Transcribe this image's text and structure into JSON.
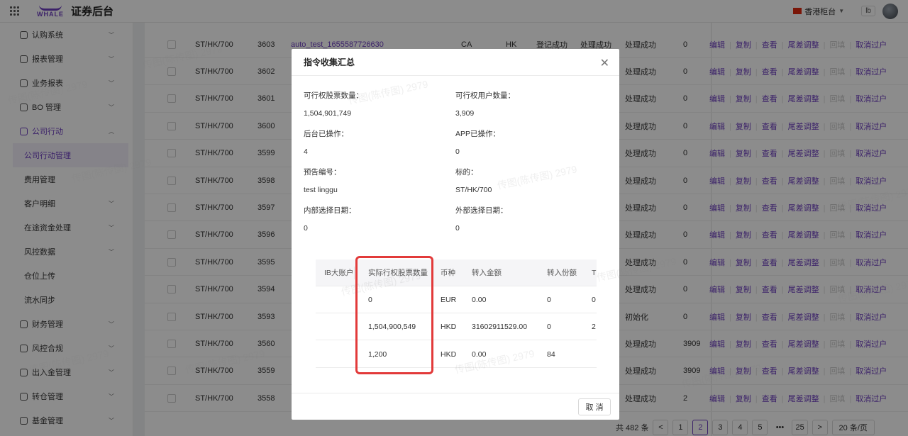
{
  "app": {
    "logo_text": "WHALE",
    "title": "证券后台",
    "region": "香港柜台",
    "user": "lb"
  },
  "sidebar": [
    {
      "label": "认购系统",
      "level": "top",
      "icon": "subscription-icon",
      "expand": "down"
    },
    {
      "label": "报表管理",
      "level": "top",
      "icon": "chart-icon",
      "expand": "down"
    },
    {
      "label": "业务报表",
      "level": "top",
      "icon": "report-icon",
      "expand": "down"
    },
    {
      "label": "BO 管理",
      "level": "top",
      "icon": "bo-icon",
      "expand": "down"
    },
    {
      "label": "公司行动",
      "level": "top",
      "icon": "calendar-icon",
      "expand": "up",
      "active": true
    },
    {
      "label": "公司行动管理",
      "level": "sub",
      "selected": true
    },
    {
      "label": "费用管理",
      "level": "sub"
    },
    {
      "label": "客户明细",
      "level": "sub",
      "expand": "down"
    },
    {
      "label": "在途资金处理",
      "level": "sub",
      "expand": "down"
    },
    {
      "label": "风控数据",
      "level": "sub",
      "expand": "down"
    },
    {
      "label": "仓位上传",
      "level": "sub"
    },
    {
      "label": "流水同步",
      "level": "sub"
    },
    {
      "label": "财务管理",
      "level": "top",
      "icon": "finance-icon",
      "expand": "down"
    },
    {
      "label": "风控合规",
      "level": "top",
      "icon": "shield-icon",
      "expand": "down"
    },
    {
      "label": "出入金管理",
      "level": "top",
      "icon": "transfer-icon",
      "expand": "down"
    },
    {
      "label": "转仓管理",
      "level": "top",
      "icon": "warehouse-icon",
      "expand": "down"
    },
    {
      "label": "基金管理",
      "level": "top",
      "icon": "fund-icon",
      "expand": "down"
    }
  ],
  "table": {
    "actions": {
      "edit": "编辑",
      "copy": "复制",
      "view": "查看",
      "adjust": "尾差调整",
      "backfill": "回填",
      "cancel": "取消过户"
    },
    "rows": [
      {
        "symbol": "ST/HK/700",
        "id": "3603",
        "name": "auto_test_1655587726630",
        "type": "CA",
        "market": "HK",
        "reg": "登记成功",
        "proc": "处理成功",
        "status": "处理成功",
        "count": "0"
      },
      {
        "symbol": "ST/HK/700",
        "id": "3602",
        "name": "",
        "type": "",
        "market": "",
        "reg": "",
        "proc": "",
        "status": "处理成功",
        "count": "0"
      },
      {
        "symbol": "ST/HK/700",
        "id": "3601",
        "name": "",
        "type": "",
        "market": "",
        "reg": "",
        "proc": "",
        "status": "处理成功",
        "count": "0"
      },
      {
        "symbol": "ST/HK/700",
        "id": "3600",
        "name": "",
        "type": "",
        "market": "",
        "reg": "",
        "proc": "",
        "status": "处理成功",
        "count": "0"
      },
      {
        "symbol": "ST/HK/700",
        "id": "3599",
        "name": "",
        "type": "",
        "market": "",
        "reg": "",
        "proc": "",
        "status": "处理成功",
        "count": "0"
      },
      {
        "symbol": "ST/HK/700",
        "id": "3598",
        "name": "",
        "type": "",
        "market": "",
        "reg": "",
        "proc": "",
        "status": "处理成功",
        "count": "0"
      },
      {
        "symbol": "ST/HK/700",
        "id": "3597",
        "name": "",
        "type": "",
        "market": "",
        "reg": "",
        "proc": "",
        "status": "处理成功",
        "count": "0"
      },
      {
        "symbol": "ST/HK/700",
        "id": "3596",
        "name": "",
        "type": "",
        "market": "",
        "reg": "",
        "proc": "",
        "status": "处理成功",
        "count": "0"
      },
      {
        "symbol": "ST/HK/700",
        "id": "3595",
        "name": "",
        "type": "",
        "market": "",
        "reg": "",
        "proc": "",
        "status": "处理成功",
        "count": "0"
      },
      {
        "symbol": "ST/HK/700",
        "id": "3594",
        "name": "",
        "type": "",
        "market": "",
        "reg": "",
        "proc": "",
        "status": "处理成功",
        "count": "0"
      },
      {
        "symbol": "ST/HK/700",
        "id": "3593",
        "name": "",
        "type": "",
        "market": "",
        "reg": "",
        "proc": "",
        "status": "初始化",
        "count": "0"
      },
      {
        "symbol": "ST/HK/700",
        "id": "3560",
        "name": "",
        "type": "",
        "market": "",
        "reg": "",
        "proc": "",
        "status": "处理成功",
        "count": "3909"
      },
      {
        "symbol": "ST/HK/700",
        "id": "3559",
        "name": "",
        "type": "",
        "market": "",
        "reg": "",
        "proc": "",
        "status": "处理成功",
        "count": "3909"
      },
      {
        "symbol": "ST/HK/700",
        "id": "3558",
        "name": "",
        "type": "",
        "market": "",
        "reg": "",
        "proc": "",
        "status": "处理成功",
        "count": "2"
      }
    ]
  },
  "pagination": {
    "total": "共 482 条",
    "prev": "<",
    "next": ">",
    "pages": [
      "1",
      "2",
      "3",
      "4",
      "5",
      "•••",
      "25"
    ],
    "current": "2",
    "page_size": "20 条/页"
  },
  "modal": {
    "title": "指令收集汇总",
    "fields": [
      {
        "label": "可行权股票数量：",
        "value": "1,504,901,749"
      },
      {
        "label": "可行权用户数量：",
        "value": "3,909"
      },
      {
        "label": "后台已操作：",
        "value": "4"
      },
      {
        "label": "APP已操作：",
        "value": "0"
      },
      {
        "label": "预告编号：",
        "value": "test linggu"
      },
      {
        "label": "标的：",
        "value": "ST/HK/700"
      },
      {
        "label": "内部选择日期：",
        "value": "0"
      },
      {
        "label": "外部选择日期：",
        "value": "0"
      }
    ],
    "table": {
      "headers": [
        "IB大账户",
        "实际行权股票数量",
        "币种",
        "转入金额",
        "转入份额",
        "T"
      ],
      "rows": [
        [
          "",
          "0",
          "EUR",
          "0.00",
          "0",
          "0"
        ],
        [
          "",
          "1,504,900,549",
          "HKD",
          "31602911529.00",
          "0",
          "2"
        ],
        [
          "",
          "1,200",
          "HKD",
          "0.00",
          "84",
          ""
        ]
      ]
    },
    "cancel": "取 消"
  },
  "watermark": "传图(陈传图) 2979",
  "colors": {
    "accent": "#6d3fc0",
    "highlight": "#e23a3a"
  }
}
